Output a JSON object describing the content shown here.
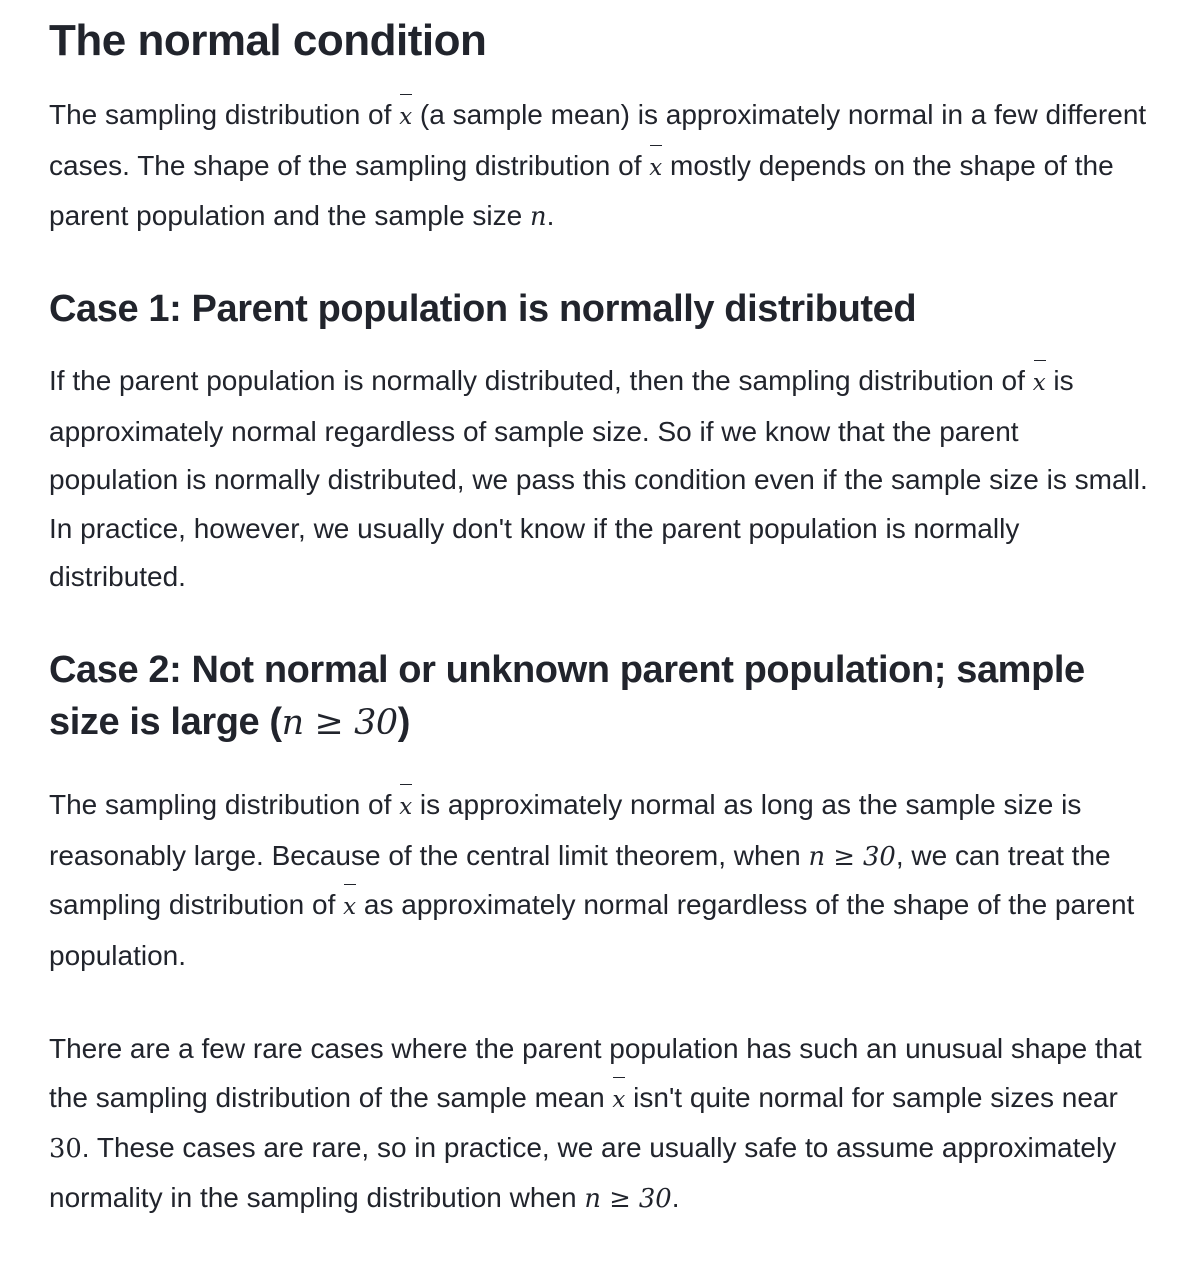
{
  "title": "The normal condition",
  "intro": {
    "t1": "The sampling distribution of ",
    "xbar": "x",
    "t2": " (a sample mean) is approximately normal in a few different cases. The shape of the sampling distribution of ",
    "t3": " mostly depends on the shape of the parent population and the sample size ",
    "n": "n",
    "t4": "."
  },
  "case1": {
    "heading": "Case 1: Parent population is normally distributed",
    "t1": "If the parent population is normally distributed, then the sampling distribution of ",
    "t2": " is approximately normal regardless of sample size. So if we know that the parent population is normally distributed, we pass this condition even if the sample size is small. In practice, however, we usually don't know if the parent population is normally distributed."
  },
  "case2": {
    "heading_text": "Case 2: Not normal or unknown parent population; sample size is large (",
    "heading_math": "n ≥ 30",
    "heading_close": ")",
    "t1": "The sampling distribution of ",
    "t2": " is approximately normal as long as the sample size is reasonably large. Because of the central limit theorem, when ",
    "math": "n ≥ 30",
    "t3": ", we can treat the sampling distribution of ",
    "t4": " as approximately normal regardless of the shape of the parent population."
  },
  "rare": {
    "t1": "There are a few rare cases where the parent population has such an unusual shape that the sampling distribution of the sample mean ",
    "t2": " isn't quite normal for sample sizes near ",
    "num": "30",
    "t3": ". These cases are rare, so in practice, we are usually safe to assume approximately normality in the sampling distribution when ",
    "math": "n ≥ 30",
    "t4": "."
  }
}
